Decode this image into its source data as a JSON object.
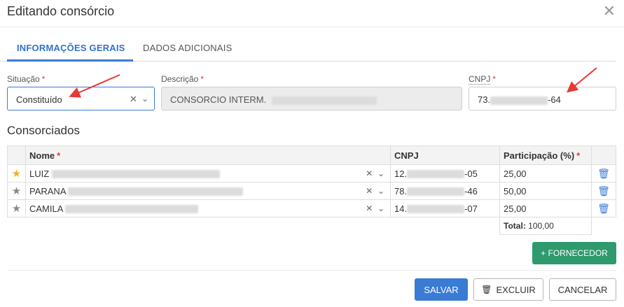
{
  "dialog": {
    "title": "Editando consórcio",
    "close_label": "✕"
  },
  "tabs": [
    {
      "label": "INFORMAÇÕES GERAIS",
      "active": true
    },
    {
      "label": "DADOS ADICIONAIS",
      "active": false
    }
  ],
  "form": {
    "situacao": {
      "label": "Situação",
      "required_mark": "*",
      "value": "Constituído"
    },
    "descricao": {
      "label": "Descrição",
      "required_mark": "*",
      "value_prefix": "CONSORCIO INTERM."
    },
    "cnpj": {
      "label": "CNPJ",
      "required_mark": "*",
      "value_prefix": "73.",
      "value_suffix": "-64"
    }
  },
  "consorciados": {
    "title": "Consorciados",
    "columns": {
      "nome": "Nome",
      "nome_required": "*",
      "cnpj": "CNPJ",
      "participacao": "Participação (%)",
      "participacao_required": "*"
    },
    "rows": [
      {
        "star": "gold",
        "nome": "LUIZ",
        "cnpj_prefix": "12.",
        "cnpj_suffix": "-05",
        "participacao": "25,00"
      },
      {
        "star": "gray",
        "nome": "PARANA",
        "cnpj_prefix": "78.",
        "cnpj_suffix": "-46",
        "participacao": "50,00"
      },
      {
        "star": "gray",
        "nome": "CAMILA",
        "cnpj_prefix": "14.",
        "cnpj_suffix": "-07",
        "participacao": "25,00"
      }
    ],
    "total_label": "Total:",
    "total_value": "100,00"
  },
  "buttons": {
    "fornecedor": "+ FORNECEDOR",
    "salvar": "SALVAR",
    "excluir": "EXCLUIR",
    "cancelar": "CANCELAR"
  },
  "colors": {
    "primary": "#3a7bd5",
    "success": "#2e9a6e",
    "required": "#e53935",
    "annotation_arrow": "#e53935"
  }
}
